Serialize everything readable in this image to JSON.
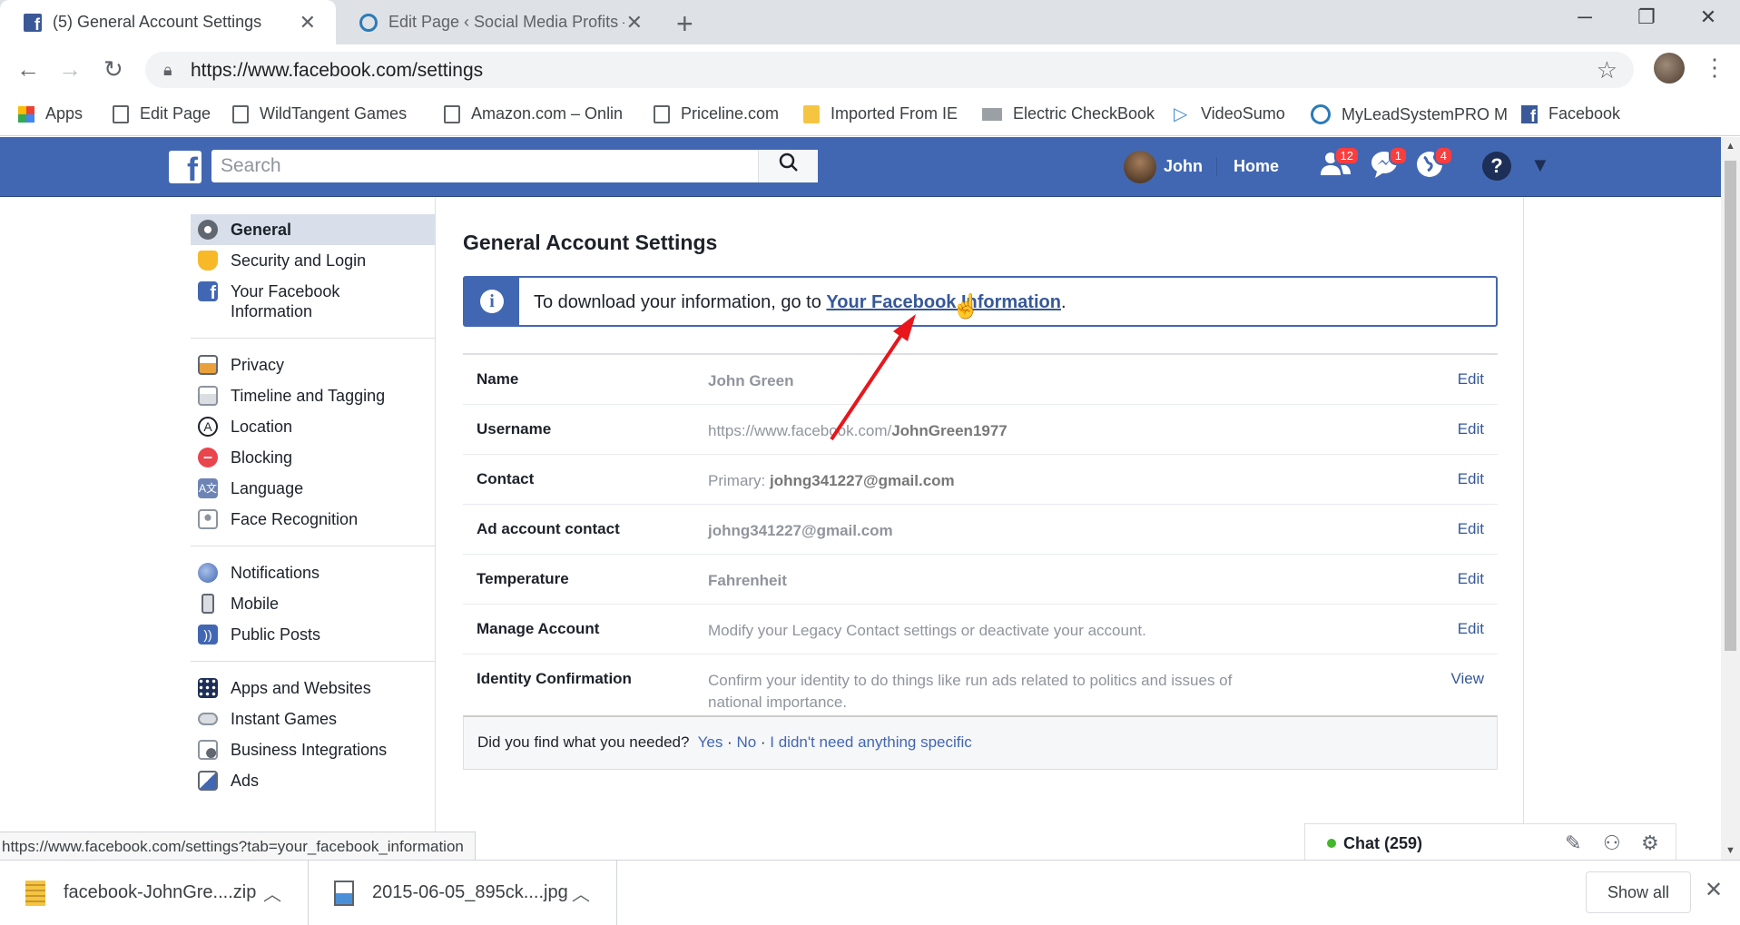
{
  "browser": {
    "tabs": [
      {
        "label": "(5) General Account Settings",
        "active": true
      },
      {
        "label": "Edit Page ‹ Social Media Profits – ",
        "active": false
      }
    ],
    "url": "https://www.facebook.com/settings",
    "bookmarks": [
      {
        "label": "Apps",
        "icon": "apps-grid-icon"
      },
      {
        "label": "Edit Page",
        "icon": "page-icon"
      },
      {
        "label": "WildTangent Games",
        "icon": "page-icon"
      },
      {
        "label": "Amazon.com – Onlin",
        "icon": "page-icon"
      },
      {
        "label": "Priceline.com",
        "icon": "page-icon"
      },
      {
        "label": "Imported From IE",
        "icon": "folder-icon"
      },
      {
        "label": "Electric CheckBook",
        "icon": "checkbook-icon"
      },
      {
        "label": "VideoSumo",
        "icon": "play-icon"
      },
      {
        "label": "MyLeadSystemPRO M",
        "icon": "mls-icon"
      },
      {
        "label": "Facebook",
        "icon": "facebook-icon"
      }
    ],
    "status_url": "https://www.facebook.com/settings?tab=your_facebook_information",
    "downloads": [
      {
        "name": "facebook-JohnGre....zip"
      },
      {
        "name": "2015-06-05_895ck....jpg"
      }
    ],
    "show_all": "Show all"
  },
  "facebook": {
    "search_placeholder": "Search",
    "user_name": "John",
    "home_label": "Home",
    "friend_requests_count": "12",
    "messages_count": "1",
    "notifications_count": "4",
    "help": "?"
  },
  "sidebar": {
    "sections": [
      [
        {
          "label": "General",
          "icon": "gear-icon",
          "active": true
        },
        {
          "label": "Security and Login",
          "icon": "shield-icon"
        },
        {
          "label": "Your Facebook Information",
          "icon": "facebook-icon"
        }
      ],
      [
        {
          "label": "Privacy",
          "icon": "lock-icon"
        },
        {
          "label": "Timeline and Tagging",
          "icon": "timeline-icon"
        },
        {
          "label": "Location",
          "icon": "location-icon"
        },
        {
          "label": "Blocking",
          "icon": "blocking-icon"
        },
        {
          "label": "Language",
          "icon": "language-icon"
        },
        {
          "label": "Face Recognition",
          "icon": "face-icon"
        }
      ],
      [
        {
          "label": "Notifications",
          "icon": "globe-icon"
        },
        {
          "label": "Mobile",
          "icon": "mobile-icon"
        },
        {
          "label": "Public Posts",
          "icon": "rss-icon"
        }
      ],
      [
        {
          "label": "Apps and Websites",
          "icon": "apps-icon"
        },
        {
          "label": "Instant Games",
          "icon": "gamepad-icon"
        },
        {
          "label": "Business Integrations",
          "icon": "business-gear-icon"
        },
        {
          "label": "Ads",
          "icon": "ads-icon"
        }
      ]
    ]
  },
  "main": {
    "title": "General Account Settings",
    "info_prefix": "To download your information, go to ",
    "info_link": "Your Facebook Information",
    "info_suffix": ".",
    "rows": [
      {
        "label": "Name",
        "value": "John Green",
        "action": "Edit"
      },
      {
        "label": "Username",
        "value_prefix": "https://www.facebook.com/",
        "value_bold": "JohnGreen1977",
        "action": "Edit"
      },
      {
        "label": "Contact",
        "value_prefix": "Primary: ",
        "value_bold": "johng341227@gmail.com",
        "action": "Edit"
      },
      {
        "label": "Ad account contact",
        "value": "johng341227@gmail.com",
        "action": "Edit"
      },
      {
        "label": "Temperature",
        "value": "Fahrenheit",
        "action": "Edit"
      },
      {
        "label": "Manage Account",
        "value": "Modify your Legacy Contact settings or deactivate your account.",
        "action": "Edit"
      },
      {
        "label": "Identity Confirmation",
        "value": "Confirm your identity to do things like run ads related to politics and issues of national importance.",
        "action": "View"
      }
    ],
    "feedback_question": "Did you find what you needed?",
    "feedback_yes": "Yes",
    "feedback_no": "No",
    "feedback_other": "I didn't need anything specific"
  },
  "chat": {
    "label": "Chat (259)"
  },
  "colors": {
    "facebook_blue": "#4267b2",
    "link": "#365899",
    "annotation_arrow": "#e8161b"
  }
}
